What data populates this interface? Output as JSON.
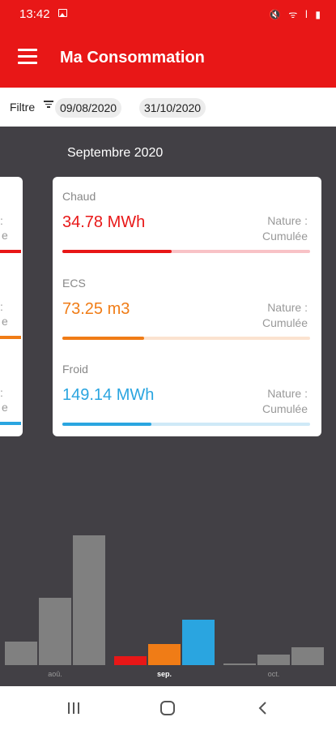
{
  "status": {
    "time": "13:42",
    "image_icon": "image-icon",
    "right_icons": "🔇 ᯤ ⅼ ▮"
  },
  "appbar": {
    "title": "Ma Consommation",
    "menu_icon": "hamburger-menu-icon"
  },
  "filter": {
    "label": "Filtre",
    "icon": "filter-icon",
    "start_date": "09/08/2020",
    "end_date": "31/10/2020"
  },
  "month": "Septembre 2020",
  "metrics": [
    {
      "label": "Chaud",
      "value": "34.78 MWh",
      "nature_line1": "Nature :",
      "nature_line2": "Cumulée",
      "color": "#e81717",
      "track": "#f8c2c6",
      "progress": 0.44
    },
    {
      "label": "ECS",
      "value": "73.25 m3",
      "nature_line1": "Nature :",
      "nature_line2": "Cumulée",
      "color": "#f07c16",
      "track": "#fbe3d0",
      "progress": 0.33
    },
    {
      "label": "Froid",
      "value": "149.14 MWh",
      "nature_line1": "Nature :",
      "nature_line2": "Cumulée",
      "color": "#2aa5e0",
      "track": "#cfe9f7",
      "progress": 0.36
    }
  ],
  "partial_card": {
    "lines": [
      ": ",
      "e",
      ": ",
      "e",
      ": ",
      "e"
    ]
  },
  "chart_data": {
    "type": "bar",
    "categories": [
      "aoû.",
      "sep.",
      "oct."
    ],
    "active_category": "sep.",
    "series": [
      {
        "values": [
          0.18,
          0.52,
          1.0
        ],
        "color": "#808080"
      },
      {
        "values": [
          0.07,
          0.16,
          0.35
        ],
        "colors": [
          "#e81717",
          "#f07c16",
          "#2aa5e0"
        ]
      },
      {
        "values": [
          0.01,
          0.08,
          0.14
        ],
        "color": "#808080"
      }
    ]
  },
  "navbar": {
    "recent_icon": "recent-apps-icon",
    "home_icon": "home-icon",
    "back_icon": "back-icon"
  }
}
